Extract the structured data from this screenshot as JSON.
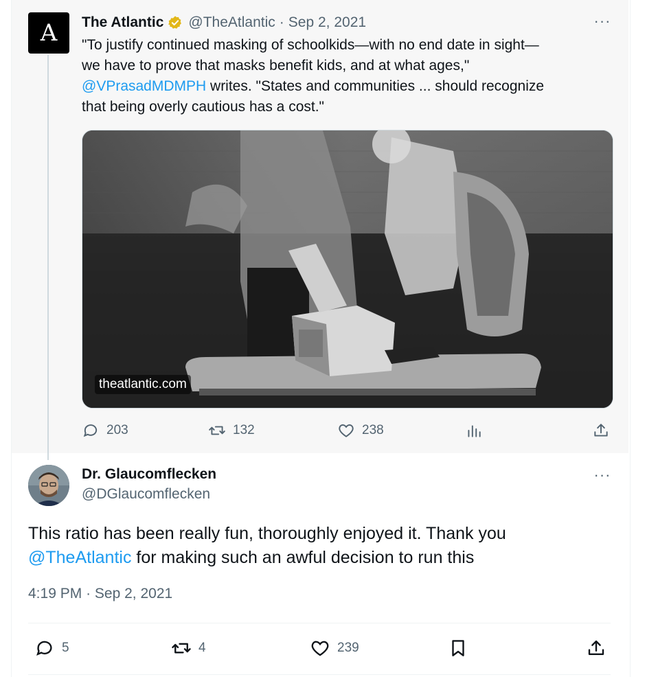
{
  "parent_tweet": {
    "avatar_letter": "A",
    "name": "The Atlantic",
    "handle": "@TheAtlantic",
    "separator": "·",
    "date": "Sep 2, 2021",
    "text_line1": "\"To justify continued masking of schoolkids—with no end date in sight—",
    "text_line2": "we have to prove that masks benefit kids, and at what ages,\"",
    "mention": "@VPrasadMDMPH",
    "text_line3_rest": " writes. \"States and communities ... should recognize",
    "text_line4": "that being overly cautious has a cost.\"",
    "media_domain": "theatlantic.com",
    "stats": {
      "replies": "203",
      "retweets": "132",
      "likes": "238"
    },
    "more_label": "···"
  },
  "reply_tweet": {
    "name": "Dr. Glaucomflecken",
    "handle": "@DGlaucomflecken",
    "text_part1": "This ratio has been really fun, thoroughly enjoyed it. Thank you",
    "mention": "@TheAtlantic",
    "text_part2": " for making such an awful decision to run this",
    "time": "4:19 PM",
    "separator": "·",
    "date": "Sep 2, 2021",
    "stats": {
      "replies": "5",
      "retweets": "4",
      "likes": "239"
    },
    "more_label": "···"
  },
  "colors": {
    "accent": "#1d9bf0",
    "secondary_text": "#536471",
    "verified_gold": "#e2b719",
    "thread_line": "#cfd9de"
  },
  "icons": [
    "reply-icon",
    "retweet-icon",
    "like-icon",
    "views-icon",
    "share-icon",
    "bookmark-icon",
    "verified-badge-icon",
    "more-icon"
  ]
}
